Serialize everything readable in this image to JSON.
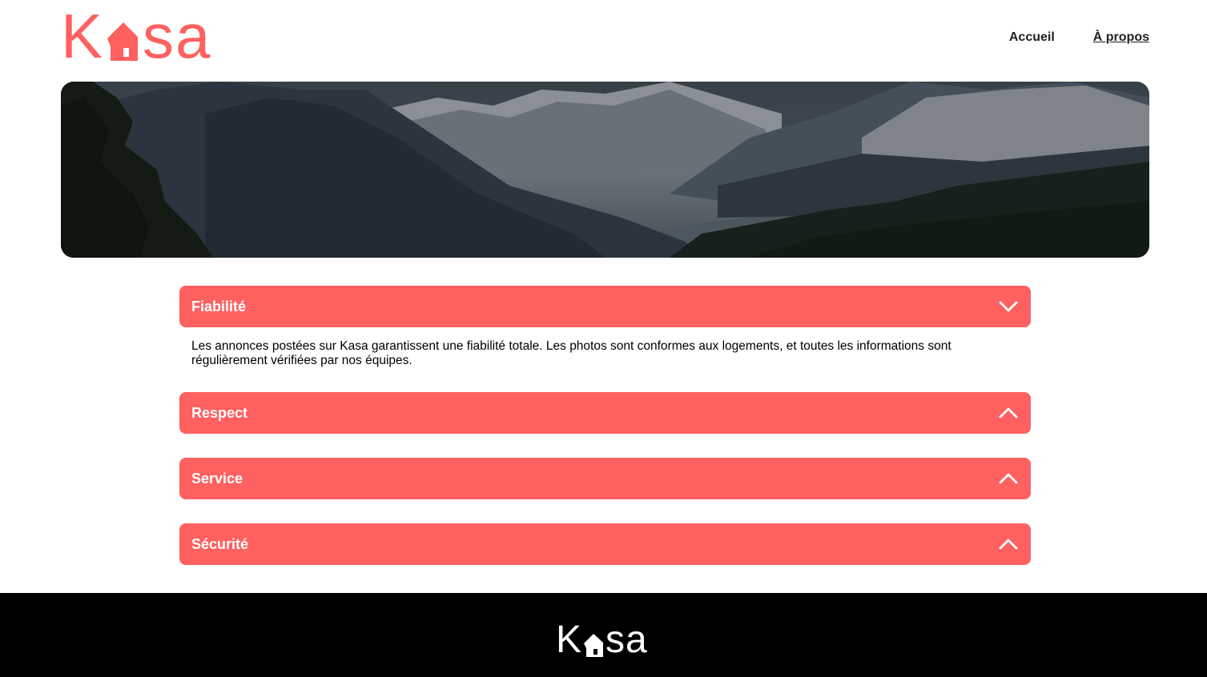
{
  "brand": {
    "logo_left": "K",
    "logo_right": "sa",
    "logo_text": "Kasa",
    "accent_color": "#FF6060",
    "footer_bg": "#000000"
  },
  "nav": {
    "home": "Accueil",
    "about": "À propos"
  },
  "banner": {
    "image": "mountain-valley-landscape"
  },
  "sections": [
    {
      "title": "Fiabilité",
      "expanded": true,
      "icon": "chevron-down-icon",
      "content": "Les annonces postées sur Kasa garantissent une fiabilité totale. Les photos sont conformes aux logements, et toutes les informations sont régulièrement vérifiées par nos équipes."
    },
    {
      "title": "Respect",
      "expanded": false,
      "icon": "chevron-up-icon"
    },
    {
      "title": "Service",
      "expanded": false,
      "icon": "chevron-up-icon"
    },
    {
      "title": "Sécurité",
      "expanded": false,
      "icon": "chevron-up-icon"
    }
  ]
}
